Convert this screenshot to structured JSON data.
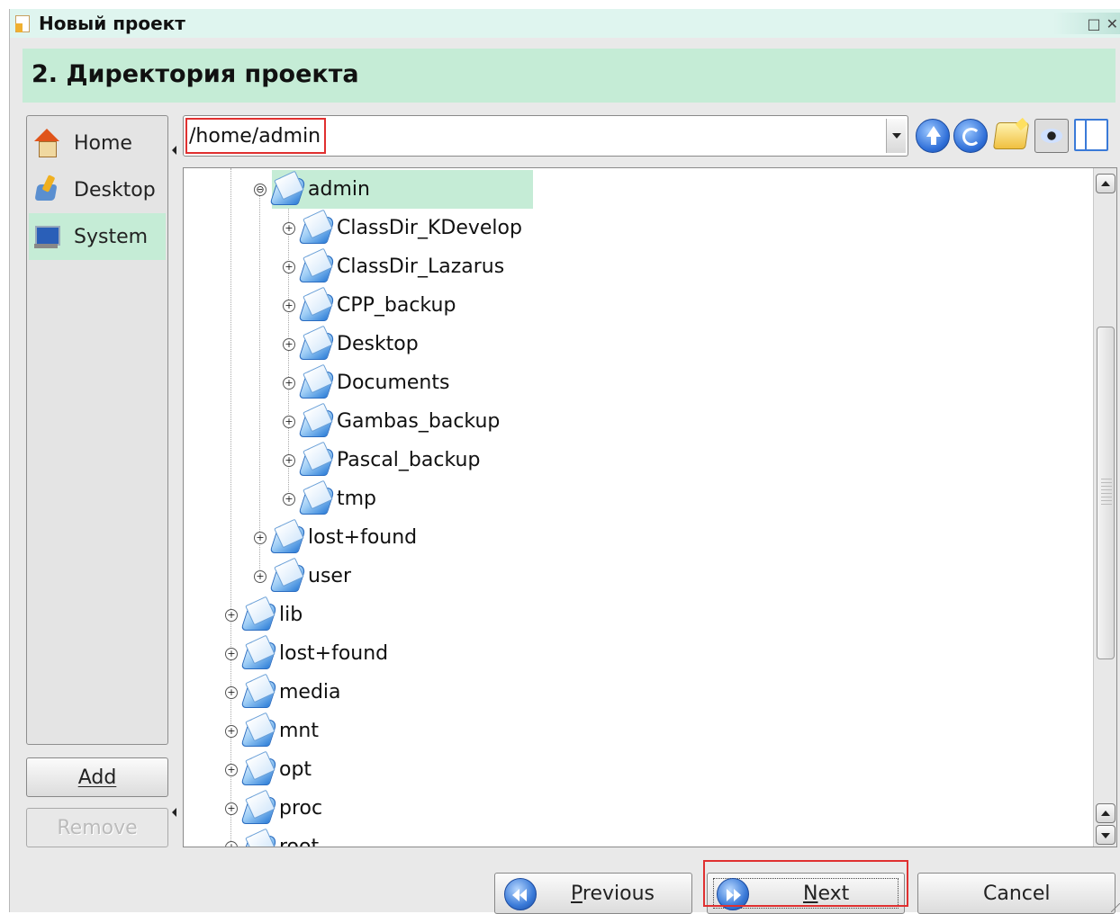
{
  "window": {
    "title": "Новый проект",
    "max_glyph": "□",
    "close_glyph": "✕"
  },
  "wizard": {
    "step_title": "2. Директория проекта"
  },
  "places": [
    {
      "label": "Home",
      "icon": "home-icon"
    },
    {
      "label": "Desktop",
      "icon": "desktop-icon"
    },
    {
      "label": "System",
      "icon": "system-icon",
      "selected": true
    }
  ],
  "places_buttons": {
    "add": "Add",
    "remove": "Remove"
  },
  "location": {
    "path": "/home/admin"
  },
  "toolbar": {
    "icons": [
      "up-icon",
      "reload-icon",
      "new-folder-icon",
      "preview-icon",
      "split-view-icon"
    ]
  },
  "tree": [
    {
      "name": "admin",
      "level": 2,
      "expanded": true,
      "selected": true
    },
    {
      "name": "ClassDir_KDevelop",
      "level": 3
    },
    {
      "name": "ClassDir_Lazarus",
      "level": 3
    },
    {
      "name": "CPP_backup",
      "level": 3
    },
    {
      "name": "Desktop",
      "level": 3
    },
    {
      "name": "Documents",
      "level": 3
    },
    {
      "name": "Gambas_backup",
      "level": 3
    },
    {
      "name": "Pascal_backup",
      "level": 3
    },
    {
      "name": "tmp",
      "level": 3
    },
    {
      "name": "lost+found",
      "level": 2
    },
    {
      "name": "user",
      "level": 2
    },
    {
      "name": "lib",
      "level": 1
    },
    {
      "name": "lost+found",
      "level": 1
    },
    {
      "name": "media",
      "level": 1
    },
    {
      "name": "mnt",
      "level": 1
    },
    {
      "name": "opt",
      "level": 1
    },
    {
      "name": "proc",
      "level": 1
    },
    {
      "name": "root",
      "level": 1
    }
  ],
  "buttons": {
    "previous_pre": "",
    "previous_mnemonic": "P",
    "previous_rest": "revious",
    "next_pre": "",
    "next_mnemonic": "N",
    "next_rest": "ext",
    "cancel": "Cancel"
  },
  "colors": {
    "selection": "#c5ecd6",
    "highlight_box": "#e03030",
    "folder": "#2f7fd8"
  }
}
